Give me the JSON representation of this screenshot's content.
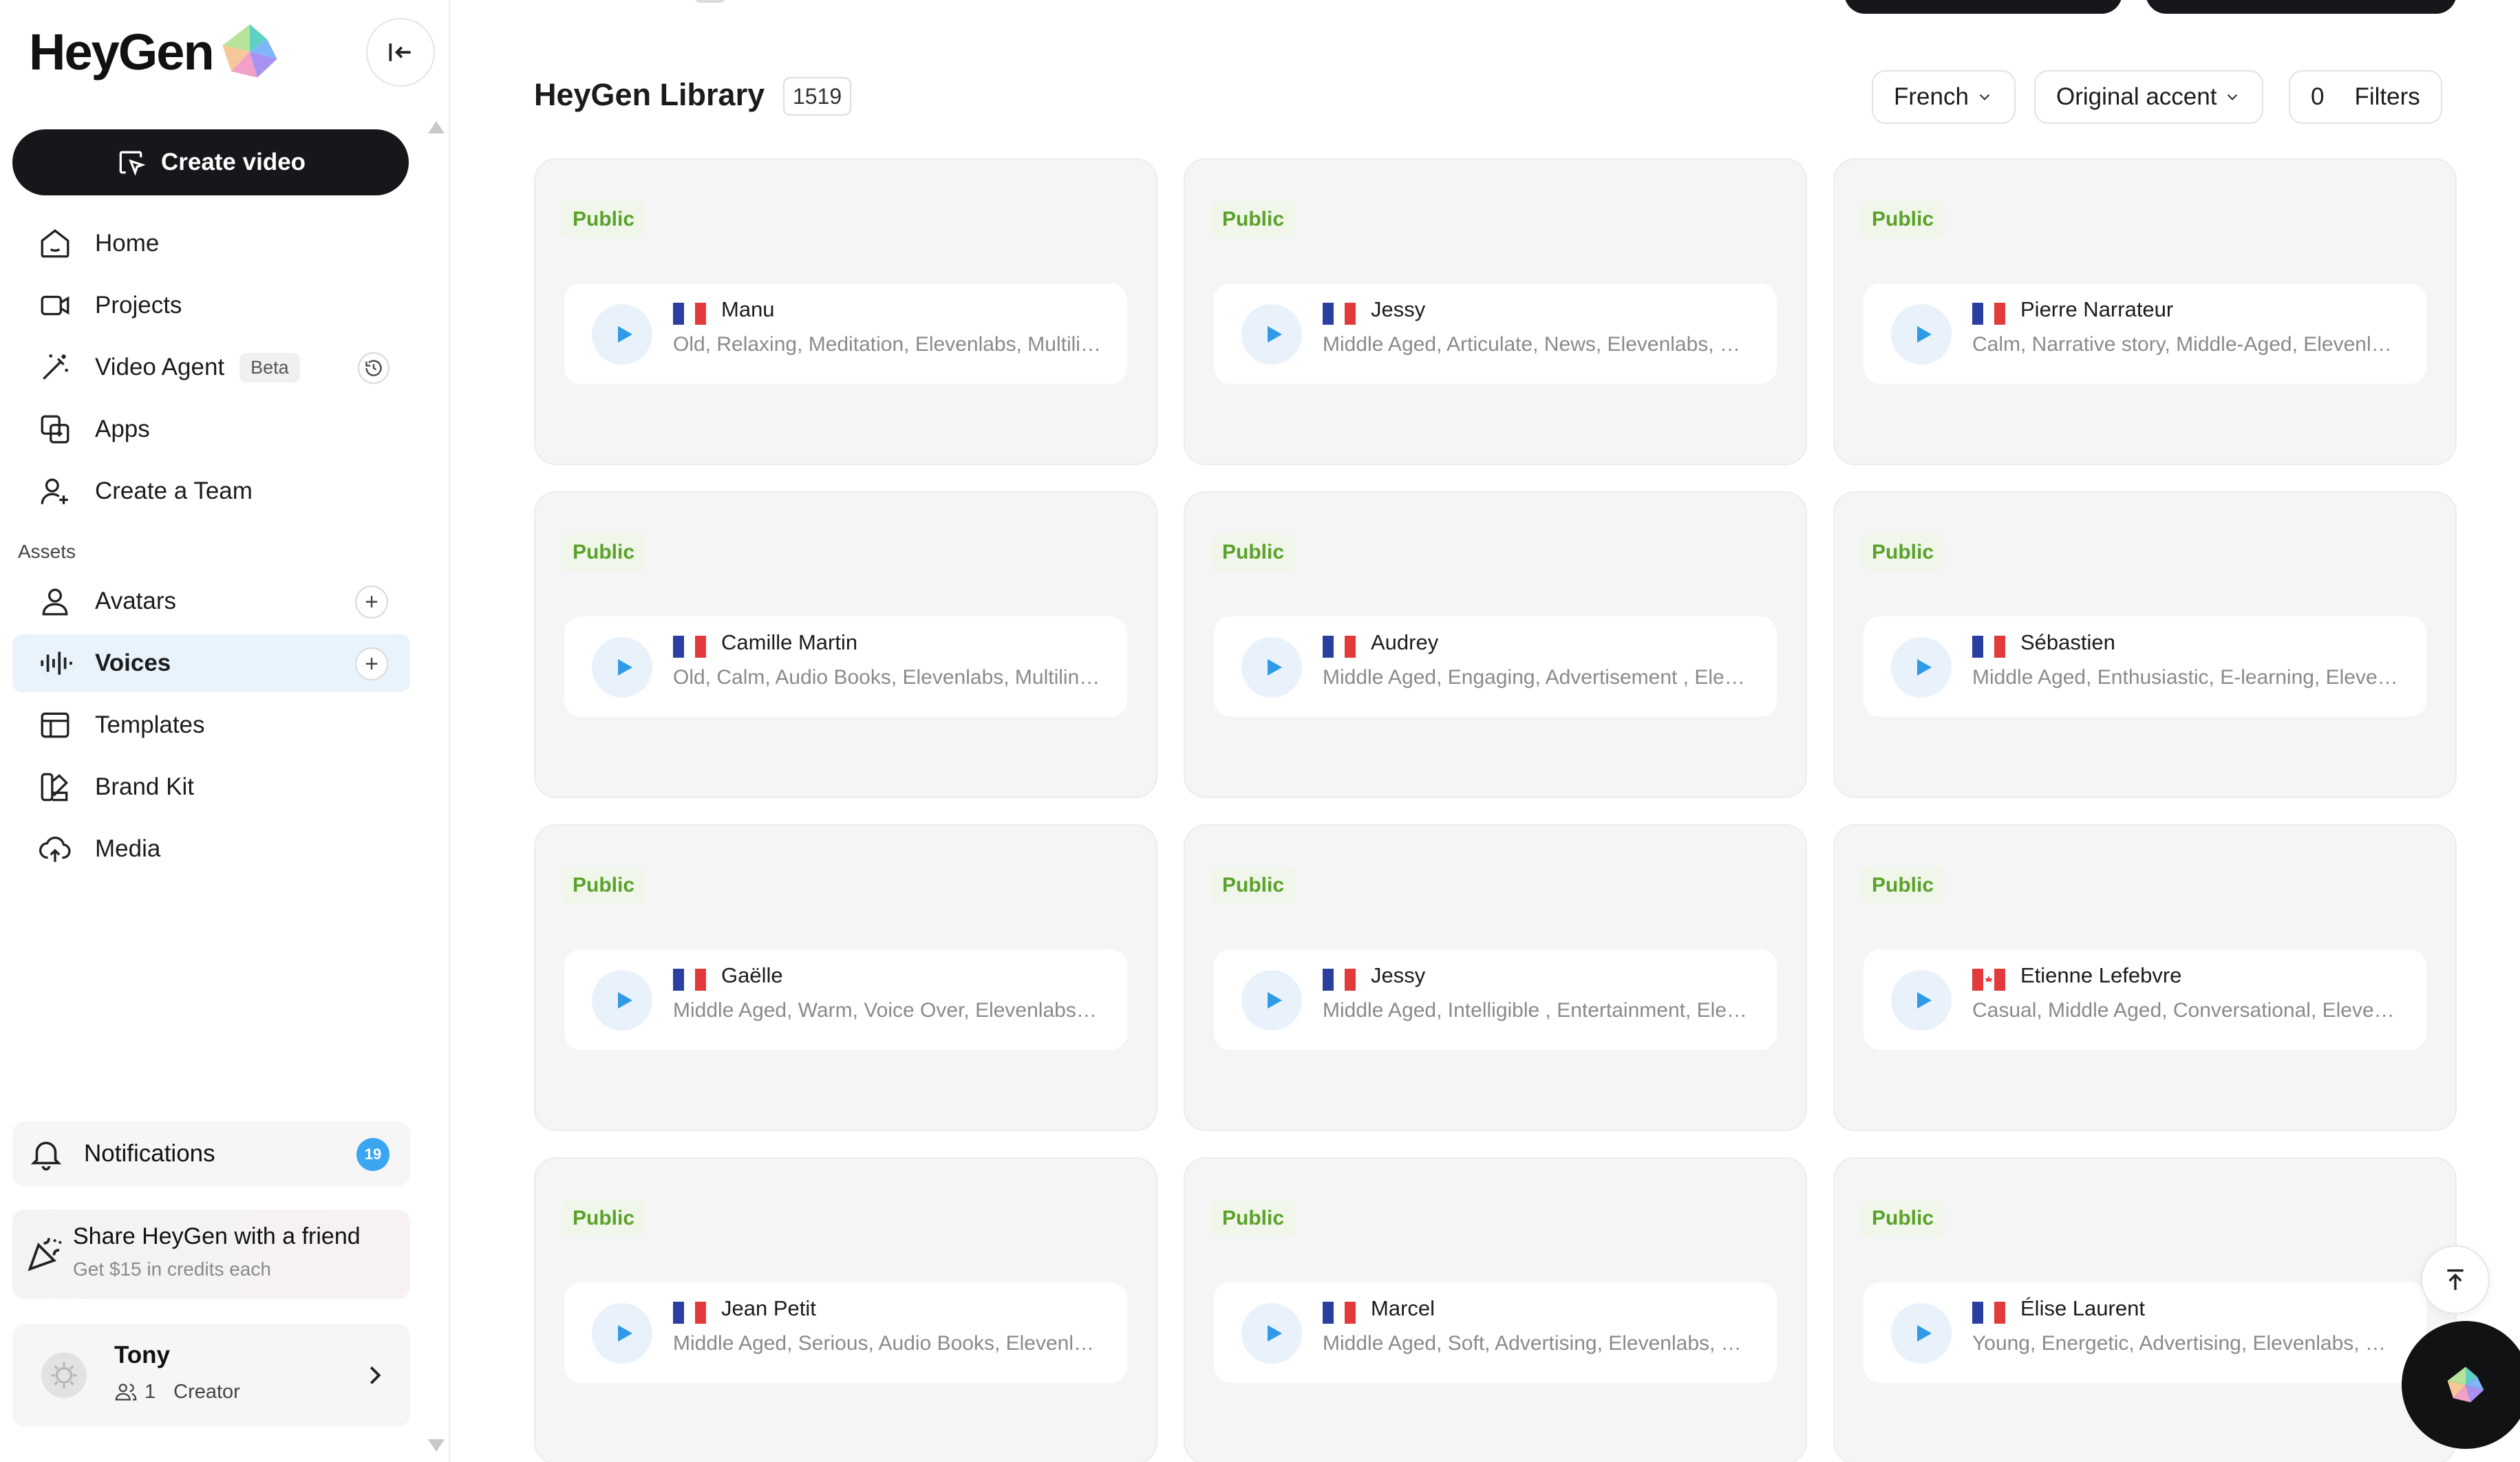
{
  "brand": {
    "name": "HeyGen"
  },
  "sidebar": {
    "create_label": "Create video",
    "items": [
      {
        "label": "Home",
        "icon": "home-icon"
      },
      {
        "label": "Projects",
        "icon": "video-camera-icon"
      },
      {
        "label": "Video Agent",
        "icon": "magic-wand-icon",
        "badge": "Beta"
      },
      {
        "label": "Apps",
        "icon": "apps-icon"
      },
      {
        "label": "Create a Team",
        "icon": "add-user-icon"
      }
    ],
    "assets_label": "Assets",
    "assets": [
      {
        "label": "Avatars",
        "icon": "user-icon"
      },
      {
        "label": "Voices",
        "icon": "audio-wave-icon",
        "active": true
      },
      {
        "label": "Templates",
        "icon": "template-icon"
      },
      {
        "label": "Brand Kit",
        "icon": "brand-kit-icon"
      },
      {
        "label": "Media",
        "icon": "cloud-upload-icon"
      }
    ],
    "notifications": {
      "label": "Notifications",
      "count": "19"
    },
    "share": {
      "title": "Share HeyGen with a friend",
      "subtitle": "Get $15 in credits each"
    },
    "user": {
      "name": "Tony",
      "seats": "1",
      "plan": "Creator"
    }
  },
  "library": {
    "title": "HeyGen Library",
    "count": "1519",
    "filters": {
      "language": "French",
      "accent": "Original accent",
      "filter_count": "0",
      "filters_label": "Filters"
    }
  },
  "voices": [
    {
      "badge": "Public",
      "name": "Manu",
      "flag": "fr",
      "desc": "Old, Relaxing, Meditation, Elevenlabs, Multilingual"
    },
    {
      "badge": "Public",
      "name": "Jessy",
      "flag": "fr",
      "desc": "Middle Aged, Articulate, News, Elevenlabs, Multilingual"
    },
    {
      "badge": "Public",
      "name": "Pierre Narrateur",
      "flag": "fr",
      "desc": "Calm, Narrative story, Middle-Aged, Elevenlabs"
    },
    {
      "badge": "Public",
      "name": "Camille Martin",
      "flag": "fr",
      "desc": "Old, Calm, Audio Books, Elevenlabs, Multilingual"
    },
    {
      "badge": "Public",
      "name": "Audrey",
      "flag": "fr",
      "desc": "Middle Aged, Engaging, Advertisement , Elevenlabs"
    },
    {
      "badge": "Public",
      "name": "Sébastien",
      "flag": "fr",
      "desc": "Middle Aged, Enthusiastic, E-learning, Elevenlabs"
    },
    {
      "badge": "Public",
      "name": "Gaëlle",
      "flag": "fr",
      "desc": "Middle Aged, Warm, Voice Over, Elevenlabs, Multilingual"
    },
    {
      "badge": "Public",
      "name": "Jessy",
      "flag": "fr",
      "desc": "Middle Aged, Intelligible , Entertainment, Elevenlabs"
    },
    {
      "badge": "Public",
      "name": "Etienne Lefebvre",
      "flag": "ca",
      "desc": "Casual, Middle Aged, Conversational, Elevenlabs"
    },
    {
      "badge": "Public",
      "name": "Jean Petit",
      "flag": "fr",
      "desc": "Middle Aged, Serious, Audio Books, Elevenlabs"
    },
    {
      "badge": "Public",
      "name": "Marcel",
      "flag": "fr",
      "desc": "Middle Aged, Soft, Advertising, Elevenlabs, Multilingual"
    },
    {
      "badge": "Public",
      "name": "Élise Laurent",
      "flag": "fr",
      "desc": "Young, Energetic, Advertising, Elevenlabs, Multilingual"
    }
  ],
  "colors": {
    "accent": "#3aa5f0",
    "public_green": "#5aa22a",
    "dark": "#16171a"
  }
}
